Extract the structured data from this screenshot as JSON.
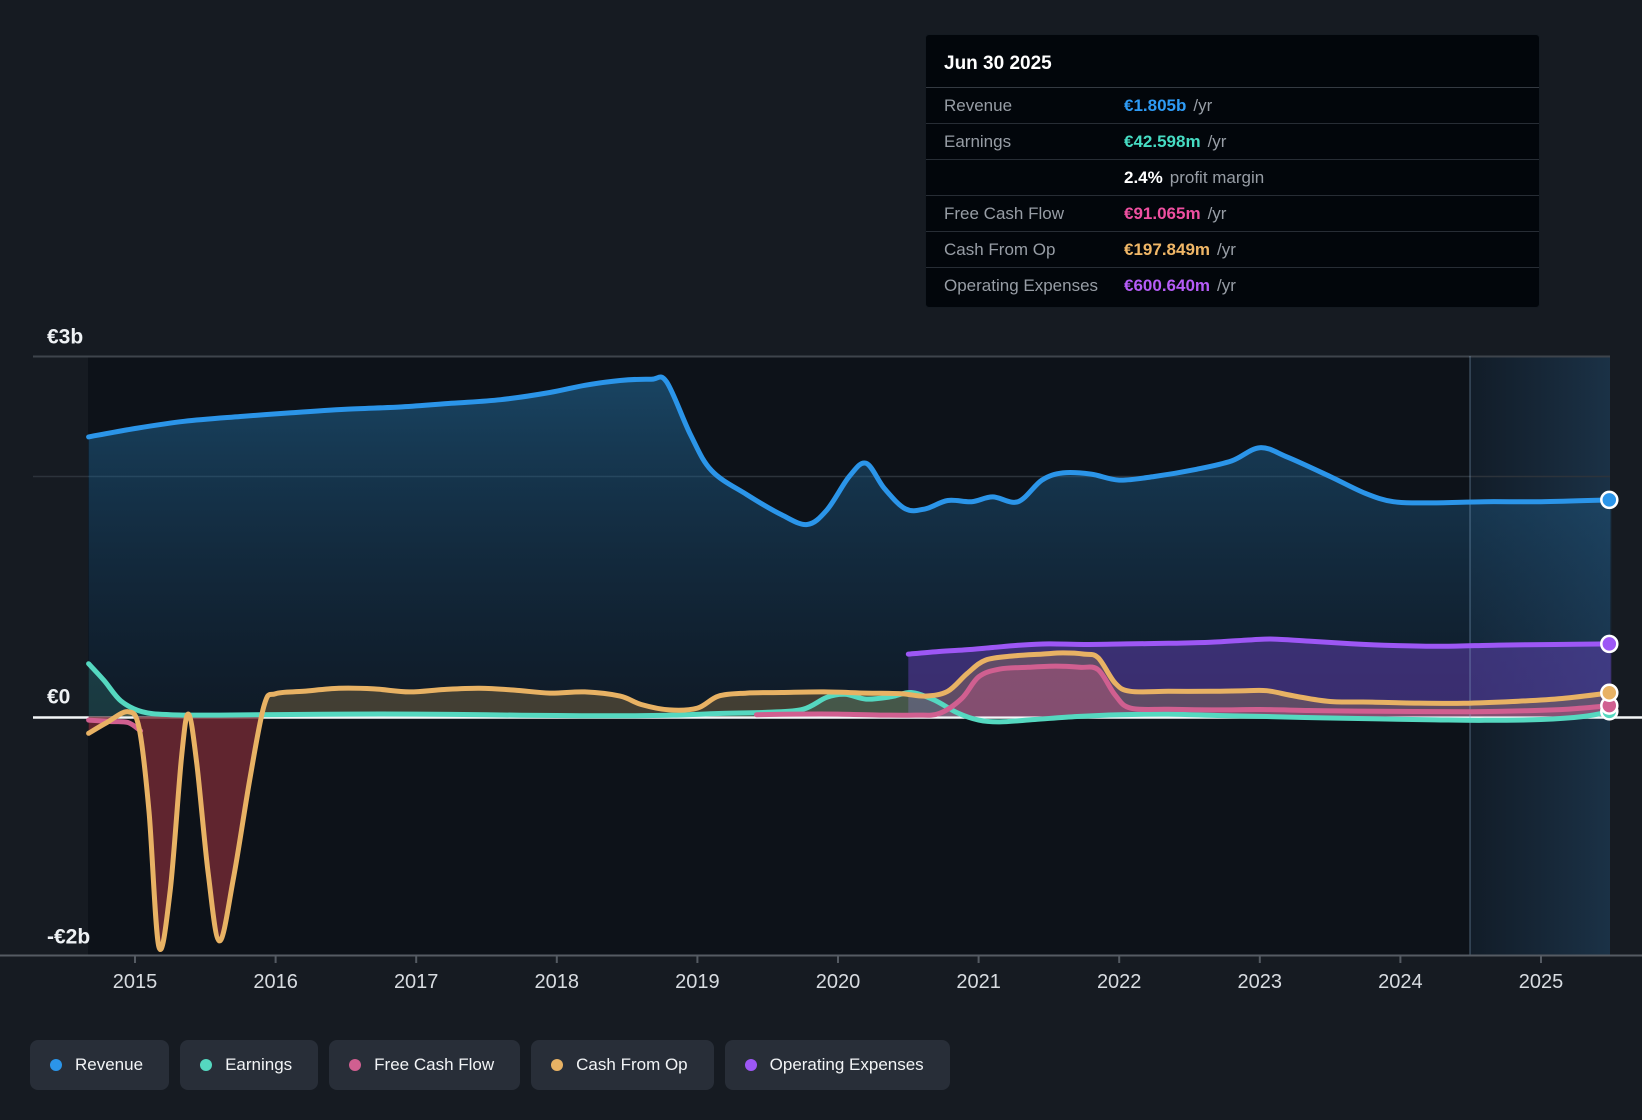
{
  "tooltip": {
    "date": "Jun 30 2025",
    "rows": [
      {
        "key": "revenue",
        "label": "Revenue",
        "value": "€1.805b",
        "unit": "/yr"
      },
      {
        "key": "earnings",
        "label": "Earnings",
        "value": "€42.598m",
        "unit": "/yr",
        "sub": {
          "strong": "2.4%",
          "text": "profit margin"
        }
      },
      {
        "key": "fcf",
        "label": "Free Cash Flow",
        "value": "€91.065m",
        "unit": "/yr"
      },
      {
        "key": "cfo",
        "label": "Cash From Op",
        "value": "€197.849m",
        "unit": "/yr"
      },
      {
        "key": "opex",
        "label": "Operating Expenses",
        "value": "€600.640m",
        "unit": "/yr"
      }
    ]
  },
  "legend": [
    {
      "key": "revenue",
      "label": "Revenue"
    },
    {
      "key": "earnings",
      "label": "Earnings"
    },
    {
      "key": "fcf",
      "label": "Free Cash Flow"
    },
    {
      "key": "cfo",
      "label": "Cash From Op"
    },
    {
      "key": "opex",
      "label": "Operating Expenses"
    }
  ],
  "colors": {
    "revenue": "#2b95e9",
    "earnings": "#55d8c0",
    "fcf": "#d05f90",
    "cfo": "#e8b264",
    "opex": "#9d57f5",
    "revenue_value": "#2e9bf5",
    "earnings_value": "#46dcc3",
    "fcf_value": "#ee4fa0",
    "cfo_value": "#f0b767",
    "opex_value": "#b55cf7"
  },
  "chart_data": {
    "type": "area",
    "x_unit": "year",
    "xlim": [
      2014.67,
      2025.5
    ],
    "ylim_billions": [
      -2,
      3
    ],
    "grid": "horizontal",
    "legend_position": "bottom",
    "y_gridlines": [
      {
        "label": "€3b",
        "value": 3
      },
      {
        "label": "",
        "value": 2
      },
      {
        "label": "€0",
        "value": 0
      },
      {
        "label": "-€2b",
        "value": -2
      }
    ],
    "x_ticks": [
      2015,
      2016,
      2017,
      2018,
      2019,
      2020,
      2021,
      2022,
      2023,
      2024,
      2025
    ],
    "past_year_divider": 2024.5,
    "series": [
      {
        "key": "revenue",
        "name": "Revenue",
        "unit": "€b",
        "points": [
          [
            2014.67,
            2.33
          ],
          [
            2015.0,
            2.4
          ],
          [
            2015.35,
            2.46
          ],
          [
            2015.75,
            2.5
          ],
          [
            2016.1,
            2.53
          ],
          [
            2016.5,
            2.56
          ],
          [
            2016.9,
            2.58
          ],
          [
            2017.25,
            2.61
          ],
          [
            2017.6,
            2.64
          ],
          [
            2017.95,
            2.7
          ],
          [
            2018.2,
            2.76
          ],
          [
            2018.45,
            2.8
          ],
          [
            2018.67,
            2.81
          ],
          [
            2018.78,
            2.79
          ],
          [
            2018.95,
            2.35
          ],
          [
            2019.1,
            2.05
          ],
          [
            2019.35,
            1.85
          ],
          [
            2019.6,
            1.68
          ],
          [
            2019.78,
            1.6
          ],
          [
            2019.92,
            1.72
          ],
          [
            2020.08,
            2.0
          ],
          [
            2020.2,
            2.11
          ],
          [
            2020.33,
            1.9
          ],
          [
            2020.48,
            1.73
          ],
          [
            2020.62,
            1.73
          ],
          [
            2020.78,
            1.8
          ],
          [
            2020.95,
            1.79
          ],
          [
            2021.1,
            1.83
          ],
          [
            2021.28,
            1.79
          ],
          [
            2021.45,
            1.97
          ],
          [
            2021.6,
            2.03
          ],
          [
            2021.8,
            2.02
          ],
          [
            2022.0,
            1.97
          ],
          [
            2022.25,
            2.0
          ],
          [
            2022.55,
            2.06
          ],
          [
            2022.8,
            2.13
          ],
          [
            2023.0,
            2.24
          ],
          [
            2023.2,
            2.16
          ],
          [
            2023.5,
            2.0
          ],
          [
            2023.75,
            1.86
          ],
          [
            2023.95,
            1.79
          ],
          [
            2024.2,
            1.78
          ],
          [
            2024.6,
            1.79
          ],
          [
            2025.0,
            1.79
          ],
          [
            2025.5,
            1.805
          ]
        ]
      },
      {
        "key": "earnings",
        "name": "Earnings",
        "unit": "€b",
        "points": [
          [
            2014.67,
            0.44
          ],
          [
            2014.78,
            0.3
          ],
          [
            2014.9,
            0.13
          ],
          [
            2015.05,
            0.04
          ],
          [
            2015.25,
            0.015
          ],
          [
            2015.6,
            0.012
          ],
          [
            2016.0,
            0.016
          ],
          [
            2016.5,
            0.02
          ],
          [
            2017.0,
            0.02
          ],
          [
            2017.5,
            0.014
          ],
          [
            2018.0,
            0.008
          ],
          [
            2018.5,
            0.006
          ],
          [
            2018.85,
            0.012
          ],
          [
            2019.15,
            0.025
          ],
          [
            2019.5,
            0.035
          ],
          [
            2019.75,
            0.06
          ],
          [
            2019.92,
            0.16
          ],
          [
            2020.05,
            0.185
          ],
          [
            2020.2,
            0.145
          ],
          [
            2020.38,
            0.165
          ],
          [
            2020.52,
            0.2
          ],
          [
            2020.68,
            0.14
          ],
          [
            2020.85,
            0.03
          ],
          [
            2021.0,
            -0.03
          ],
          [
            2021.15,
            -0.045
          ],
          [
            2021.4,
            -0.025
          ],
          [
            2021.7,
            0.0
          ],
          [
            2022.0,
            0.015
          ],
          [
            2022.35,
            0.02
          ],
          [
            2022.7,
            0.008
          ],
          [
            2023.05,
            0.0
          ],
          [
            2023.45,
            -0.012
          ],
          [
            2023.85,
            -0.02
          ],
          [
            2024.25,
            -0.028
          ],
          [
            2024.6,
            -0.032
          ],
          [
            2025.0,
            -0.025
          ],
          [
            2025.3,
            0.0
          ],
          [
            2025.5,
            0.043
          ]
        ]
      },
      {
        "key": "fcf",
        "name": "Free Cash Flow",
        "unit": "€b",
        "points": [
          [
            2019.42,
            0.015
          ],
          [
            2019.7,
            0.02
          ],
          [
            2020.0,
            0.02
          ],
          [
            2020.3,
            0.012
          ],
          [
            2020.55,
            0.012
          ],
          [
            2020.72,
            0.025
          ],
          [
            2020.88,
            0.15
          ],
          [
            2021.0,
            0.33
          ],
          [
            2021.15,
            0.395
          ],
          [
            2021.35,
            0.41
          ],
          [
            2021.55,
            0.42
          ],
          [
            2021.72,
            0.41
          ],
          [
            2021.85,
            0.39
          ],
          [
            2021.97,
            0.18
          ],
          [
            2022.08,
            0.07
          ],
          [
            2022.35,
            0.06
          ],
          [
            2022.7,
            0.055
          ],
          [
            2023.0,
            0.058
          ],
          [
            2023.35,
            0.05
          ],
          [
            2023.7,
            0.045
          ],
          [
            2024.1,
            0.042
          ],
          [
            2024.5,
            0.04
          ],
          [
            2024.9,
            0.048
          ],
          [
            2025.2,
            0.062
          ],
          [
            2025.5,
            0.091
          ]
        ]
      },
      {
        "key": "fcf_intro",
        "name": "Free Cash Flow (2014 stub)",
        "unit": "€b",
        "points": [
          [
            2014.67,
            -0.03
          ],
          [
            2014.82,
            -0.042
          ],
          [
            2014.95,
            -0.05
          ],
          [
            2015.04,
            -0.12
          ]
        ]
      },
      {
        "key": "cfo",
        "name": "Cash From Op",
        "unit": "€b",
        "points": [
          [
            2014.67,
            -0.14
          ],
          [
            2014.8,
            -0.05
          ],
          [
            2014.95,
            0.04
          ],
          [
            2015.03,
            -0.1
          ],
          [
            2015.1,
            -0.8
          ],
          [
            2015.17,
            -1.92
          ],
          [
            2015.25,
            -1.45
          ],
          [
            2015.33,
            -0.35
          ],
          [
            2015.38,
            0.02
          ],
          [
            2015.44,
            -0.4
          ],
          [
            2015.52,
            -1.3
          ],
          [
            2015.6,
            -1.87
          ],
          [
            2015.7,
            -1.35
          ],
          [
            2015.82,
            -0.5
          ],
          [
            2015.92,
            0.1
          ],
          [
            2016.0,
            0.19
          ],
          [
            2016.2,
            0.21
          ],
          [
            2016.45,
            0.235
          ],
          [
            2016.7,
            0.23
          ],
          [
            2016.95,
            0.205
          ],
          [
            2017.2,
            0.225
          ],
          [
            2017.45,
            0.235
          ],
          [
            2017.7,
            0.22
          ],
          [
            2017.95,
            0.195
          ],
          [
            2018.2,
            0.205
          ],
          [
            2018.45,
            0.17
          ],
          [
            2018.6,
            0.1
          ],
          [
            2018.8,
            0.055
          ],
          [
            2019.0,
            0.07
          ],
          [
            2019.15,
            0.17
          ],
          [
            2019.35,
            0.195
          ],
          [
            2019.6,
            0.2
          ],
          [
            2019.9,
            0.205
          ],
          [
            2020.2,
            0.195
          ],
          [
            2020.45,
            0.19
          ],
          [
            2020.62,
            0.17
          ],
          [
            2020.78,
            0.21
          ],
          [
            2020.92,
            0.36
          ],
          [
            2021.05,
            0.47
          ],
          [
            2021.25,
            0.505
          ],
          [
            2021.45,
            0.52
          ],
          [
            2021.6,
            0.53
          ],
          [
            2021.75,
            0.52
          ],
          [
            2021.85,
            0.49
          ],
          [
            2021.97,
            0.28
          ],
          [
            2022.08,
            0.21
          ],
          [
            2022.35,
            0.21
          ],
          [
            2022.65,
            0.21
          ],
          [
            2022.9,
            0.215
          ],
          [
            2023.05,
            0.215
          ],
          [
            2023.25,
            0.17
          ],
          [
            2023.5,
            0.125
          ],
          [
            2023.8,
            0.12
          ],
          [
            2024.1,
            0.112
          ],
          [
            2024.45,
            0.11
          ],
          [
            2024.8,
            0.125
          ],
          [
            2025.15,
            0.15
          ],
          [
            2025.5,
            0.198
          ]
        ]
      },
      {
        "key": "opex",
        "name": "Operating Expenses",
        "unit": "€b",
        "points": [
          [
            2020.5,
            0.52
          ],
          [
            2020.7,
            0.54
          ],
          [
            2020.9,
            0.555
          ],
          [
            2021.1,
            0.575
          ],
          [
            2021.3,
            0.595
          ],
          [
            2021.5,
            0.605
          ],
          [
            2021.75,
            0.6
          ],
          [
            2022.05,
            0.605
          ],
          [
            2022.35,
            0.61
          ],
          [
            2022.65,
            0.618
          ],
          [
            2022.95,
            0.64
          ],
          [
            2023.1,
            0.645
          ],
          [
            2023.35,
            0.628
          ],
          [
            2023.65,
            0.607
          ],
          [
            2023.95,
            0.592
          ],
          [
            2024.3,
            0.585
          ],
          [
            2024.7,
            0.595
          ],
          [
            2025.1,
            0.6
          ],
          [
            2025.5,
            0.605
          ]
        ]
      }
    ],
    "endpoints": [
      {
        "key": "revenue",
        "value_b": 1.805
      },
      {
        "key": "opex",
        "value_b": 0.605
      },
      {
        "key": "cfo",
        "value_b": 0.198
      },
      {
        "key": "fcf",
        "value_b": 0.091
      },
      {
        "key": "earnings",
        "value_b": 0.043
      }
    ]
  }
}
